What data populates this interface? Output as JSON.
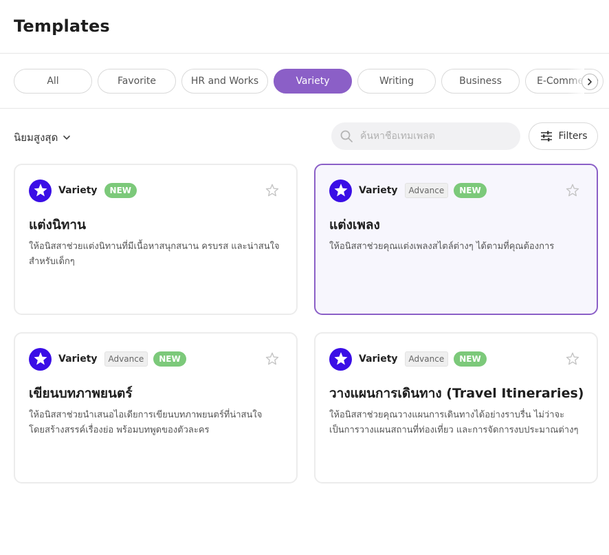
{
  "page": {
    "title": "Templates"
  },
  "tabs": [
    {
      "label": "All",
      "active": false
    },
    {
      "label": "Favorite",
      "active": false
    },
    {
      "label": "HR and Works",
      "active": false
    },
    {
      "label": "Variety",
      "active": true
    },
    {
      "label": "Writing",
      "active": false
    },
    {
      "label": "Business",
      "active": false
    },
    {
      "label": "E-Commerce",
      "active": false
    }
  ],
  "toolbar": {
    "sort_label": "นิยมสูงสุด",
    "search_placeholder": "ค้นหาชื่อเทมเพลต",
    "search_value": "",
    "filters_label": "Filters"
  },
  "cards": [
    {
      "category": "Variety",
      "advance": "",
      "new_badge": "NEW",
      "title": "แต่งนิทาน",
      "description": "ให้อนิสสาช่วยแต่งนิทานที่มีเนื้อหาสนุกสนาน ครบรส และน่าสนใจสำหรับเด็กๆ",
      "favorite": false,
      "selected": false
    },
    {
      "category": "Variety",
      "advance": "Advance",
      "new_badge": "NEW",
      "title": "แต่งเพลง",
      "description": "ให้อนิสสาช่วยคุณแต่งเพลงสไตล์ต่างๆ ได้ตามที่คุณต้องการ",
      "favorite": false,
      "selected": true
    },
    {
      "category": "Variety",
      "advance": "Advance",
      "new_badge": "NEW",
      "title": "เขียนบทภาพยนตร์",
      "description": "ให้อนิสสาช่วยนำเสนอไอเดียการเขียนบทภาพยนตร์ที่น่าสนใจ โดยสร้างสรรค์เรื่องย่อ พร้อมบทพูดของตัวละคร",
      "favorite": false,
      "selected": false
    },
    {
      "category": "Variety",
      "advance": "Advance",
      "new_badge": "NEW",
      "title": "วางแผนการเดินทาง (Travel Itineraries)",
      "description": "ให้อนิสสาช่วยคุณวางแผนการเดินทางได้อย่างราบรื่น ไม่ว่าจะเป็นการวางแผนสถานที่ท่องเที่ยว และการจัดการงบประมาณต่างๆ",
      "favorite": false,
      "selected": false
    }
  ],
  "colors": {
    "accent": "#8b5fc7",
    "icon_bg": "#3a0ee6",
    "new_badge": "#7cc97a"
  },
  "icons": {
    "category": "star-badge-icon",
    "favorite": "star-outline-icon",
    "search": "search-icon",
    "filters": "sliders-icon",
    "sort": "chevron-down-icon",
    "tabs_next": "chevron-right-icon"
  }
}
